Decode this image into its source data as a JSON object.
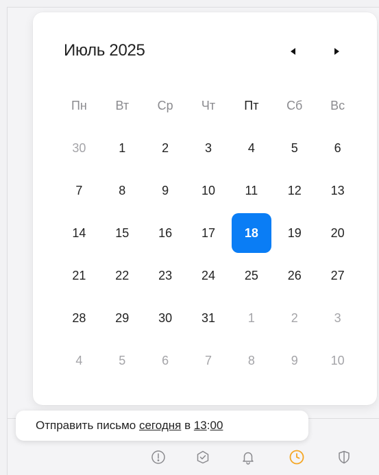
{
  "calendar": {
    "month_title": "Июль 2025",
    "weekdays": [
      "Пн",
      "Вт",
      "Ср",
      "Чт",
      "Пт",
      "Сб",
      "Вс"
    ],
    "today_weekday_index": 4,
    "weeks": [
      [
        {
          "d": "30",
          "muted": true
        },
        {
          "d": "1"
        },
        {
          "d": "2"
        },
        {
          "d": "3"
        },
        {
          "d": "4"
        },
        {
          "d": "5"
        },
        {
          "d": "6"
        }
      ],
      [
        {
          "d": "7"
        },
        {
          "d": "8"
        },
        {
          "d": "9"
        },
        {
          "d": "10"
        },
        {
          "d": "11"
        },
        {
          "d": "12"
        },
        {
          "d": "13"
        }
      ],
      [
        {
          "d": "14"
        },
        {
          "d": "15"
        },
        {
          "d": "16"
        },
        {
          "d": "17"
        },
        {
          "d": "18",
          "selected": true
        },
        {
          "d": "19"
        },
        {
          "d": "20"
        }
      ],
      [
        {
          "d": "21"
        },
        {
          "d": "22"
        },
        {
          "d": "23"
        },
        {
          "d": "24"
        },
        {
          "d": "25"
        },
        {
          "d": "26"
        },
        {
          "d": "27"
        }
      ],
      [
        {
          "d": "28"
        },
        {
          "d": "29"
        },
        {
          "d": "30"
        },
        {
          "d": "31"
        },
        {
          "d": "1",
          "muted": true
        },
        {
          "d": "2",
          "muted": true
        },
        {
          "d": "3",
          "muted": true
        }
      ],
      [
        {
          "d": "4",
          "muted": true
        },
        {
          "d": "5",
          "muted": true
        },
        {
          "d": "6",
          "muted": true
        },
        {
          "d": "7",
          "muted": true
        },
        {
          "d": "8",
          "muted": true
        },
        {
          "d": "9",
          "muted": true
        },
        {
          "d": "10",
          "muted": true
        }
      ]
    ],
    "accent_color": "#0a7df5"
  },
  "tooltip": {
    "prefix": "Отправить письмо",
    "day_link": "сегодня",
    "middle": "в",
    "time_hour": "13",
    "time_sep": ":",
    "time_minute": "00"
  },
  "toolbar": {
    "icons": [
      "exclamation-circle-icon",
      "checkmark-check-icon",
      "bell-icon",
      "clock-icon",
      "shield-icon"
    ],
    "active_icon": "clock-icon",
    "active_color": "#f5a623",
    "icon_color": "#8a8a8e"
  }
}
